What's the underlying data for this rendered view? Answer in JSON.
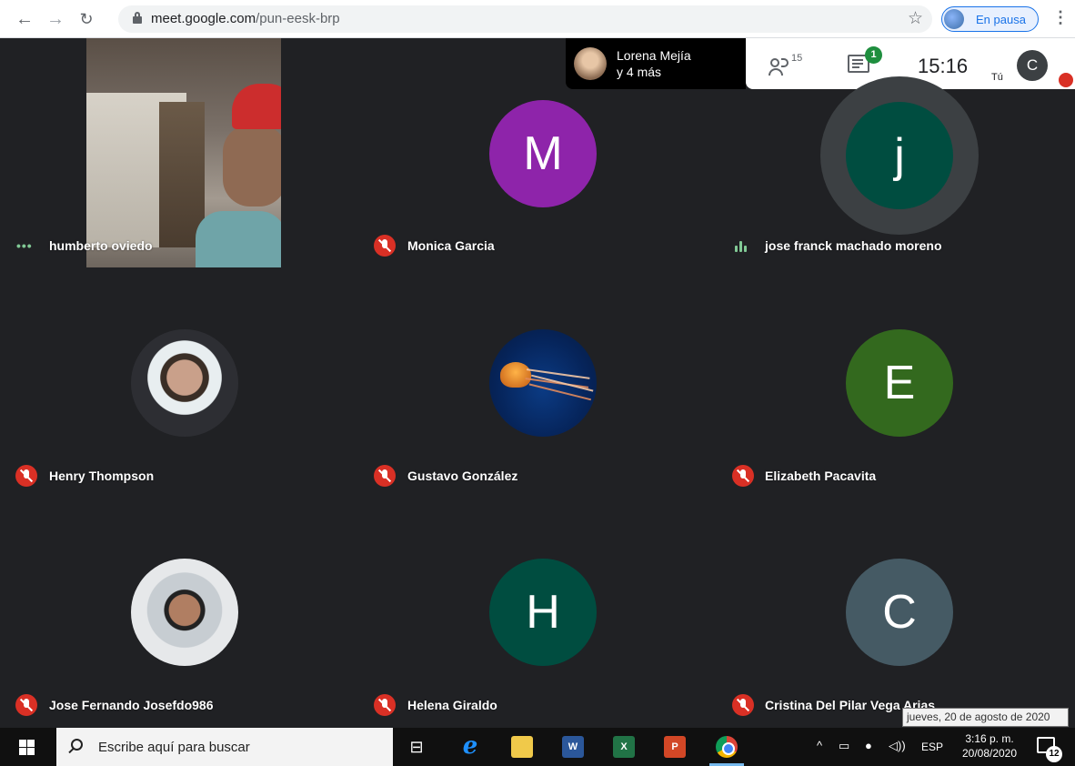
{
  "browser": {
    "url_host": "meet.google.com",
    "url_path": "/pun-eesk-brp",
    "profile_status": "En pausa"
  },
  "meet_topbar": {
    "presenter_name": "Lorena Mejía",
    "presenter_more": "y 4 más",
    "participant_count": "15",
    "chat_badge": "1",
    "time": "15:16",
    "self_label": "Tú",
    "self_initial": "C"
  },
  "tiles": [
    {
      "name": "humberto oviedo",
      "status": "speaking-dots",
      "avatar_type": "video"
    },
    {
      "name": "Monica Garcia",
      "status": "muted",
      "initial": "M",
      "color": "#8e24aa"
    },
    {
      "name": "jose franck machado moreno",
      "status": "speaking-bars",
      "initial": "j",
      "color": "#004d40"
    },
    {
      "name": "Henry Thompson",
      "status": "muted",
      "avatar_type": "photo"
    },
    {
      "name": "Gustavo González",
      "status": "muted",
      "avatar_type": "photo"
    },
    {
      "name": "Elizabeth Pacavita",
      "status": "muted",
      "initial": "E",
      "color": "#33691e"
    },
    {
      "name": "Jose Fernando Josefdo986",
      "status": "muted",
      "avatar_type": "photo"
    },
    {
      "name": "Helena Giraldo",
      "status": "muted",
      "initial": "H",
      "color": "#004d40"
    },
    {
      "name": "Cristina Del Pilar Vega Arias",
      "status": "muted",
      "initial": "C",
      "color": "#455a64"
    }
  ],
  "tooltip": "jueves, 20 de agosto de 2020",
  "taskbar": {
    "search_placeholder": "Escribe aquí para buscar",
    "language": "ESP",
    "clock_time": "3:16 p. m.",
    "clock_date": "20/08/2020",
    "notification_count": "12"
  },
  "colors": {
    "meet_bg": "#202124",
    "muted_red": "#d93025",
    "speaking_green": "#81c995",
    "accent_blue": "#1a73e8"
  }
}
